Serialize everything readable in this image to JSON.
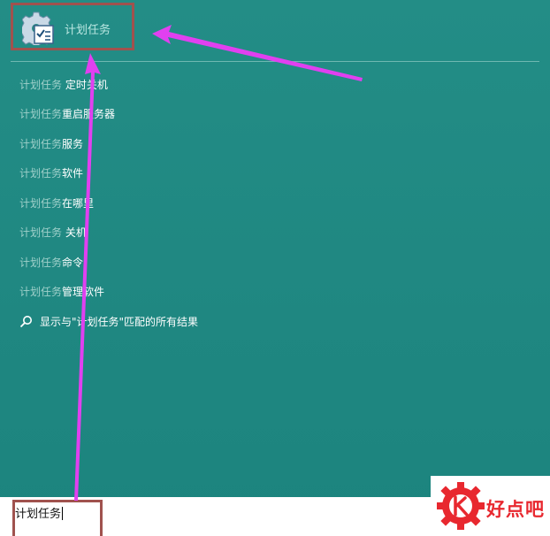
{
  "top_result": {
    "label": "计划任务",
    "icon": "task-scheduler-icon"
  },
  "suggestions": [
    {
      "prefix": "计划任务",
      "suffix": " 定时关机"
    },
    {
      "prefix": "计划任务",
      "suffix": "重启服务器"
    },
    {
      "prefix": "计划任务",
      "suffix": "服务"
    },
    {
      "prefix": "计划任务",
      "suffix": "软件"
    },
    {
      "prefix": "计划任务",
      "suffix": "在哪里"
    },
    {
      "prefix": "计划任务",
      "suffix": " 关机"
    },
    {
      "prefix": "计划任务",
      "suffix": "命令"
    },
    {
      "prefix": "计划任务",
      "suffix": "管理软件"
    }
  ],
  "search_all": {
    "label": "显示与\"计划任务\"匹配的所有结果",
    "icon": "search-icon"
  },
  "search_box": {
    "value": "计划任务"
  },
  "watermark": {
    "text": "好点吧",
    "icon": "gear-logo-icon"
  },
  "colors": {
    "panel": "#1f8a82",
    "highlight_border": "#a0524e",
    "arrow": "#e040f0"
  }
}
